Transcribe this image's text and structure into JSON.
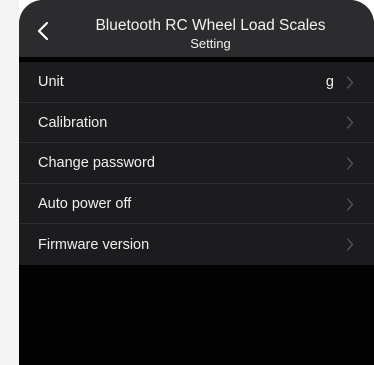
{
  "header": {
    "title": "Bluetooth RC Wheel Load Scales",
    "subtitle": "Setting",
    "back_icon": "chevron-left-icon"
  },
  "menu": {
    "items": [
      {
        "label": "Unit",
        "value": "g",
        "icon": "chevron-right-icon"
      },
      {
        "label": "Calibration",
        "value": "",
        "icon": "chevron-right-icon"
      },
      {
        "label": "Change password",
        "value": "",
        "icon": "chevron-right-icon"
      },
      {
        "label": "Auto power off",
        "value": "",
        "icon": "chevron-right-icon"
      },
      {
        "label": "Firmware version",
        "value": "",
        "icon": "chevron-right-icon"
      }
    ]
  },
  "colors": {
    "header_bg": "#2c2c2e",
    "menu_bg": "#1c1c1e",
    "screen_bg": "#020202",
    "text": "#f0f0f0",
    "chevron": "#5a5a5e"
  }
}
